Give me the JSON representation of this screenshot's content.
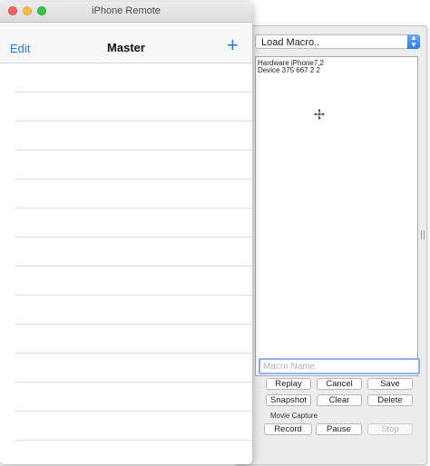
{
  "iphone_window": {
    "title": "iPhone Remote",
    "nav": {
      "edit_label": "Edit",
      "title": "Master",
      "add_label": "+"
    },
    "row_count": 13
  },
  "macro_panel": {
    "load_dropdown": {
      "selected": "Load Macro.."
    },
    "log_lines": [
      "Hardware iPhone7,2",
      "Device 375 667 2 2"
    ],
    "macro_name_placeholder": "Macro Name",
    "buttons": {
      "replay": "Replay",
      "cancel": "Cancel",
      "save": "Save",
      "snapshot": "Snapshot",
      "clear": "Clear",
      "delete": "Delete"
    },
    "movie_capture": {
      "label": "Movie Capture",
      "record": "Record",
      "pause": "Pause",
      "stop": "Stop"
    }
  },
  "colors": {
    "ios_blue": "#2a7de1",
    "close": "#fc605b",
    "minimize": "#fdbc40",
    "zoom": "#34c84a",
    "focus_ring": "#8ab4f5"
  }
}
